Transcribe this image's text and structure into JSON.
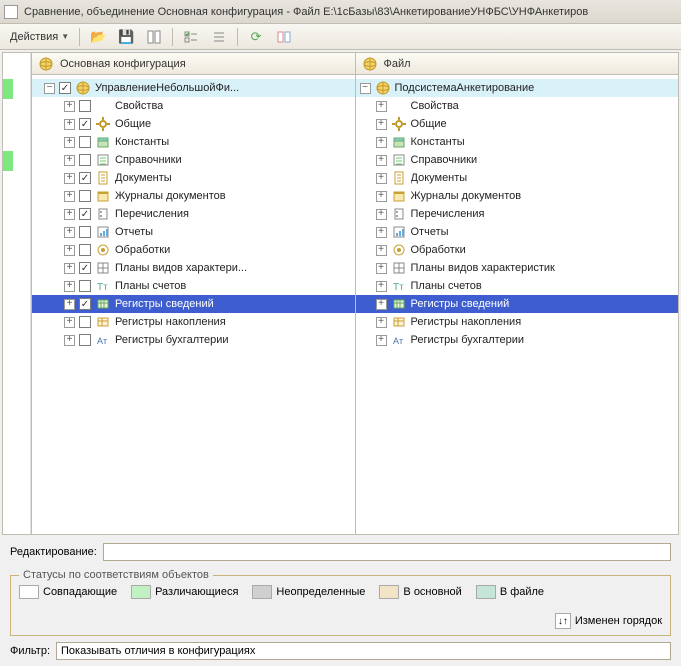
{
  "title": "Сравнение, объединение Основная конфигурация - Файл E:\\1сБазы\\83\\АнкетированиеУНФБС\\УНФАнкетиров",
  "toolbar": {
    "actions": "Действия"
  },
  "left_header": "Основная конфигурация",
  "right_header": "Файл",
  "left_tree": {
    "root": "УправлениеНебольшойФи...",
    "items": [
      {
        "label": "Свойства",
        "checked": false,
        "kind": "props"
      },
      {
        "label": "Общие",
        "checked": true,
        "kind": "gear"
      },
      {
        "label": "Константы",
        "checked": false,
        "kind": "const"
      },
      {
        "label": "Справочники",
        "checked": false,
        "kind": "ref"
      },
      {
        "label": "Документы",
        "checked": true,
        "kind": "doc"
      },
      {
        "label": "Журналы документов",
        "checked": false,
        "kind": "journal"
      },
      {
        "label": "Перечисления",
        "checked": true,
        "kind": "enum"
      },
      {
        "label": "Отчеты",
        "checked": false,
        "kind": "report"
      },
      {
        "label": "Обработки",
        "checked": false,
        "kind": "proc"
      },
      {
        "label": "Планы видов характери...",
        "checked": true,
        "kind": "plan"
      },
      {
        "label": "Планы счетов",
        "checked": false,
        "kind": "acct"
      },
      {
        "label": "Регистры сведений",
        "checked": true,
        "kind": "info",
        "selected": true
      },
      {
        "label": "Регистры накопления",
        "checked": false,
        "kind": "accum"
      },
      {
        "label": "Регистры бухгалтерии",
        "checked": false,
        "kind": "book"
      }
    ]
  },
  "right_tree": {
    "root": "ПодсистемаАнкетирование",
    "items": [
      {
        "label": "Свойства",
        "kind": "props"
      },
      {
        "label": "Общие",
        "kind": "gear"
      },
      {
        "label": "Константы",
        "kind": "const"
      },
      {
        "label": "Справочники",
        "kind": "ref"
      },
      {
        "label": "Документы",
        "kind": "doc"
      },
      {
        "label": "Журналы документов",
        "kind": "journal"
      },
      {
        "label": "Перечисления",
        "kind": "enum"
      },
      {
        "label": "Отчеты",
        "kind": "report"
      },
      {
        "label": "Обработки",
        "kind": "proc"
      },
      {
        "label": "Планы видов характеристик",
        "kind": "plan"
      },
      {
        "label": "Планы счетов",
        "kind": "acct"
      },
      {
        "label": "Регистры сведений",
        "kind": "info",
        "selected": true
      },
      {
        "label": "Регистры накопления",
        "kind": "accum"
      },
      {
        "label": "Регистры бухгалтерии",
        "kind": "book"
      }
    ]
  },
  "edit_label": "Редактирование:",
  "edit_value": "",
  "status_legend": "Статусы по соответствиям объектов",
  "status": {
    "s1": "Совпадающие",
    "s2": "Различающиеся",
    "s3": "Неопределенные",
    "s4": "В основной",
    "s5": "В файле",
    "order": "Изменен горядок"
  },
  "filter_label": "Фильтр:",
  "filter_value": "Показывать отличия в конфигурациях",
  "icon_map": {
    "props": "",
    "gear": "gear",
    "const": "const",
    "ref": "ref",
    "doc": "doc",
    "journal": "journal",
    "enum": "enum",
    "report": "report",
    "proc": "proc",
    "plan": "plan",
    "acct": "acct",
    "info": "info",
    "accum": "accum",
    "book": "book"
  }
}
